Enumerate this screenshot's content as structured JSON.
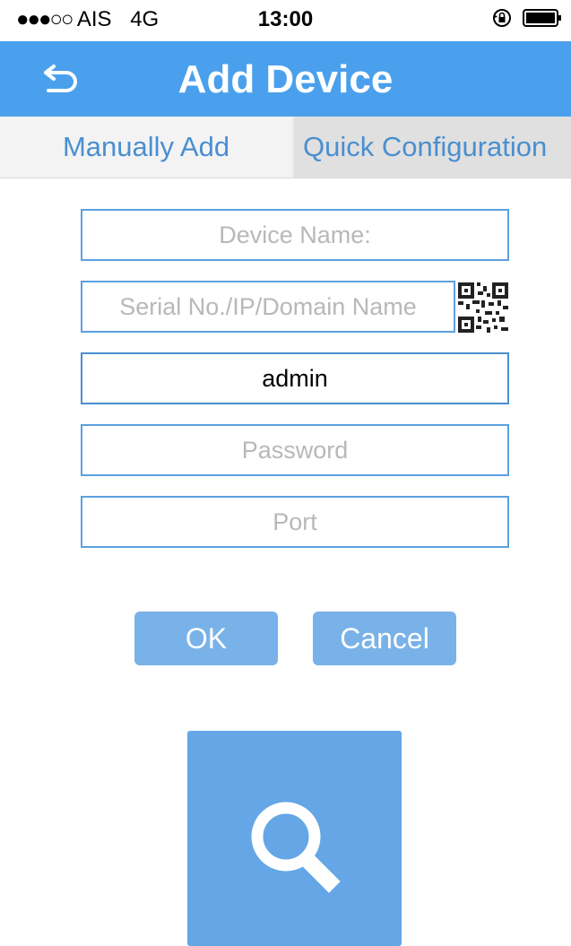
{
  "status_bar": {
    "signal": "●●●○○",
    "carrier": "AIS",
    "network": "4G",
    "time": "13:00",
    "icons": [
      "rotation-lock-icon",
      "battery-icon"
    ]
  },
  "nav": {
    "title": "Add Device",
    "back_icon": "back-arrow-icon",
    "background": "#4aa0ec"
  },
  "tabs": [
    {
      "label": "Manually Add",
      "selected": true
    },
    {
      "label": "Quick Configuration",
      "selected": false
    }
  ],
  "form": {
    "device_name": {
      "placeholder": "Device Name:",
      "value": ""
    },
    "serial": {
      "placeholder": "Serial No./IP/Domain Name",
      "value": "",
      "icon": "qr-code-icon"
    },
    "username": {
      "placeholder": "",
      "value": "admin"
    },
    "password": {
      "placeholder": "Password",
      "value": ""
    },
    "port": {
      "placeholder": "Port",
      "value": ""
    }
  },
  "buttons": {
    "ok": "OK",
    "cancel": "Cancel",
    "color": "#79b2e8"
  },
  "search_tile": {
    "icon": "search-icon",
    "color": "#64a6e6"
  }
}
